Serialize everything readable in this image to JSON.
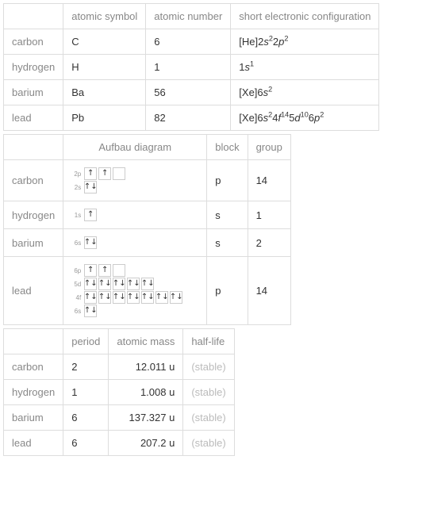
{
  "table1": {
    "headers": [
      "atomic symbol",
      "atomic number",
      "short electronic configuration"
    ],
    "rows": [
      {
        "name": "carbon",
        "symbol": "C",
        "number": "6",
        "conf_html": "[He]2<span class='i'>s</span><sup>2</sup>2<span class='i'>p</span><sup>2</sup>"
      },
      {
        "name": "hydrogen",
        "symbol": "H",
        "number": "1",
        "conf_html": "1<span class='i'>s</span><sup>1</sup>"
      },
      {
        "name": "barium",
        "symbol": "Ba",
        "number": "56",
        "conf_html": "[Xe]6<span class='i'>s</span><sup>2</sup>"
      },
      {
        "name": "lead",
        "symbol": "Pb",
        "number": "82",
        "conf_html": "[Xe]6<span class='i'>s</span><sup>2</sup>4<span class='i'>f</span><sup>14</sup>5<span class='i'>d</span><sup>10</sup>6<span class='i'>p</span><sup>2</sup>"
      }
    ]
  },
  "table2": {
    "headers": [
      "Aufbau diagram",
      "block",
      "group"
    ],
    "rows": [
      {
        "name": "carbon",
        "block": "p",
        "group": "14",
        "orbitals": [
          {
            "label": "2p",
            "boxes": [
              "↑",
              "↑",
              ""
            ]
          },
          {
            "label": "2s",
            "boxes": [
              "↑↓"
            ]
          }
        ]
      },
      {
        "name": "hydrogen",
        "block": "s",
        "group": "1",
        "orbitals": [
          {
            "label": "1s",
            "boxes": [
              "↑"
            ]
          }
        ]
      },
      {
        "name": "barium",
        "block": "s",
        "group": "2",
        "orbitals": [
          {
            "label": "6s",
            "boxes": [
              "↑↓"
            ]
          }
        ]
      },
      {
        "name": "lead",
        "block": "p",
        "group": "14",
        "orbitals": [
          {
            "label": "6p",
            "boxes": [
              "↑",
              "↑",
              ""
            ]
          },
          {
            "label": "5d",
            "boxes": [
              "↑↓",
              "↑↓",
              "↑↓",
              "↑↓",
              "↑↓"
            ]
          },
          {
            "label": "4f",
            "boxes": [
              "↑↓",
              "↑↓",
              "↑↓",
              "↑↓",
              "↑↓",
              "↑↓",
              "↑↓"
            ]
          },
          {
            "label": "6s",
            "boxes": [
              "↑↓"
            ]
          }
        ]
      }
    ]
  },
  "table3": {
    "headers": [
      "period",
      "atomic mass",
      "half-life"
    ],
    "rows": [
      {
        "name": "carbon",
        "period": "2",
        "mass": "12.011 u",
        "half": "(stable)"
      },
      {
        "name": "hydrogen",
        "period": "1",
        "mass": "1.008 u",
        "half": "(stable)"
      },
      {
        "name": "barium",
        "period": "6",
        "mass": "137.327 u",
        "half": "(stable)"
      },
      {
        "name": "lead",
        "period": "6",
        "mass": "207.2 u",
        "half": "(stable)"
      }
    ]
  },
  "chart_data": {
    "type": "table",
    "elements": [
      {
        "name": "carbon",
        "symbol": "C",
        "atomic_number": 6,
        "config": "[He]2s2 2p2",
        "block": "p",
        "group": 14,
        "period": 2,
        "atomic_mass_u": 12.011,
        "half_life": "stable"
      },
      {
        "name": "hydrogen",
        "symbol": "H",
        "atomic_number": 1,
        "config": "1s1",
        "block": "s",
        "group": 1,
        "period": 1,
        "atomic_mass_u": 1.008,
        "half_life": "stable"
      },
      {
        "name": "barium",
        "symbol": "Ba",
        "atomic_number": 56,
        "config": "[Xe]6s2",
        "block": "s",
        "group": 2,
        "period": 6,
        "atomic_mass_u": 137.327,
        "half_life": "stable"
      },
      {
        "name": "lead",
        "symbol": "Pb",
        "atomic_number": 82,
        "config": "[Xe]6s2 4f14 5d10 6p2",
        "block": "p",
        "group": 14,
        "period": 6,
        "atomic_mass_u": 207.2,
        "half_life": "stable"
      }
    ]
  }
}
